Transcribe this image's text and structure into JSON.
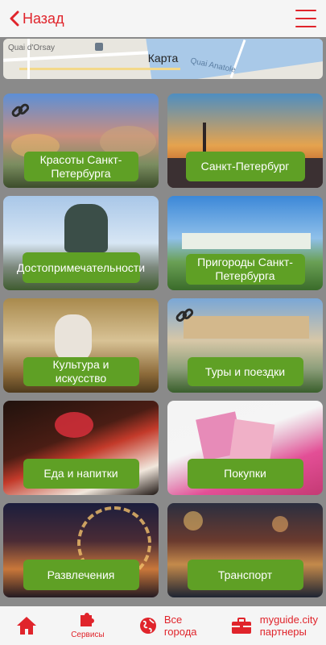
{
  "header": {
    "back_label": "Назад"
  },
  "map": {
    "label": "Карта",
    "street_1": "Quai d'Orsay",
    "street_2": "Quai Anatole"
  },
  "tiles": [
    {
      "label": "Красоты Санкт-Петербурга",
      "has_link_icon": true
    },
    {
      "label": "Санкт-Петербург",
      "has_link_icon": false
    },
    {
      "label": "Достопримечательности",
      "has_link_icon": false
    },
    {
      "label": "Пригороды Санкт-Петербурга",
      "has_link_icon": false
    },
    {
      "label": "Культура и искусство",
      "has_link_icon": false
    },
    {
      "label": "Туры и поездки",
      "has_link_icon": true
    },
    {
      "label": "Еда и напитки",
      "has_link_icon": false
    },
    {
      "label": "Покупки",
      "has_link_icon": false
    },
    {
      "label": "Развлечения",
      "has_link_icon": false
    },
    {
      "label": "Транспорт",
      "has_link_icon": false
    }
  ],
  "bottom_nav": {
    "home_icon": "home-icon",
    "services_label": "Сервисы",
    "cities_label_1": "Все",
    "cities_label_2": "города",
    "partners_label_1": "myguide.city",
    "partners_label_2": "партнеры"
  },
  "colors": {
    "accent": "#e0242b",
    "pill": "#5fa025"
  }
}
